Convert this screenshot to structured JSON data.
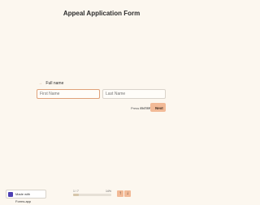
{
  "form": {
    "title": "Appeal Application Form"
  },
  "question": {
    "label": "Full name",
    "fields": {
      "first_placeholder": "First Name",
      "last_placeholder": "Last Name"
    },
    "hint_prefix": "Press",
    "hint_key": "ENTER",
    "next_label": "Next"
  },
  "footer": {
    "badge_text": "Made with Forms.app",
    "progress_count": "1 / 7",
    "progress_percent_label": "14%",
    "progress_fraction": 0.14
  },
  "colors": {
    "background": "#fcf7ef",
    "accent": "#f2ba97"
  }
}
